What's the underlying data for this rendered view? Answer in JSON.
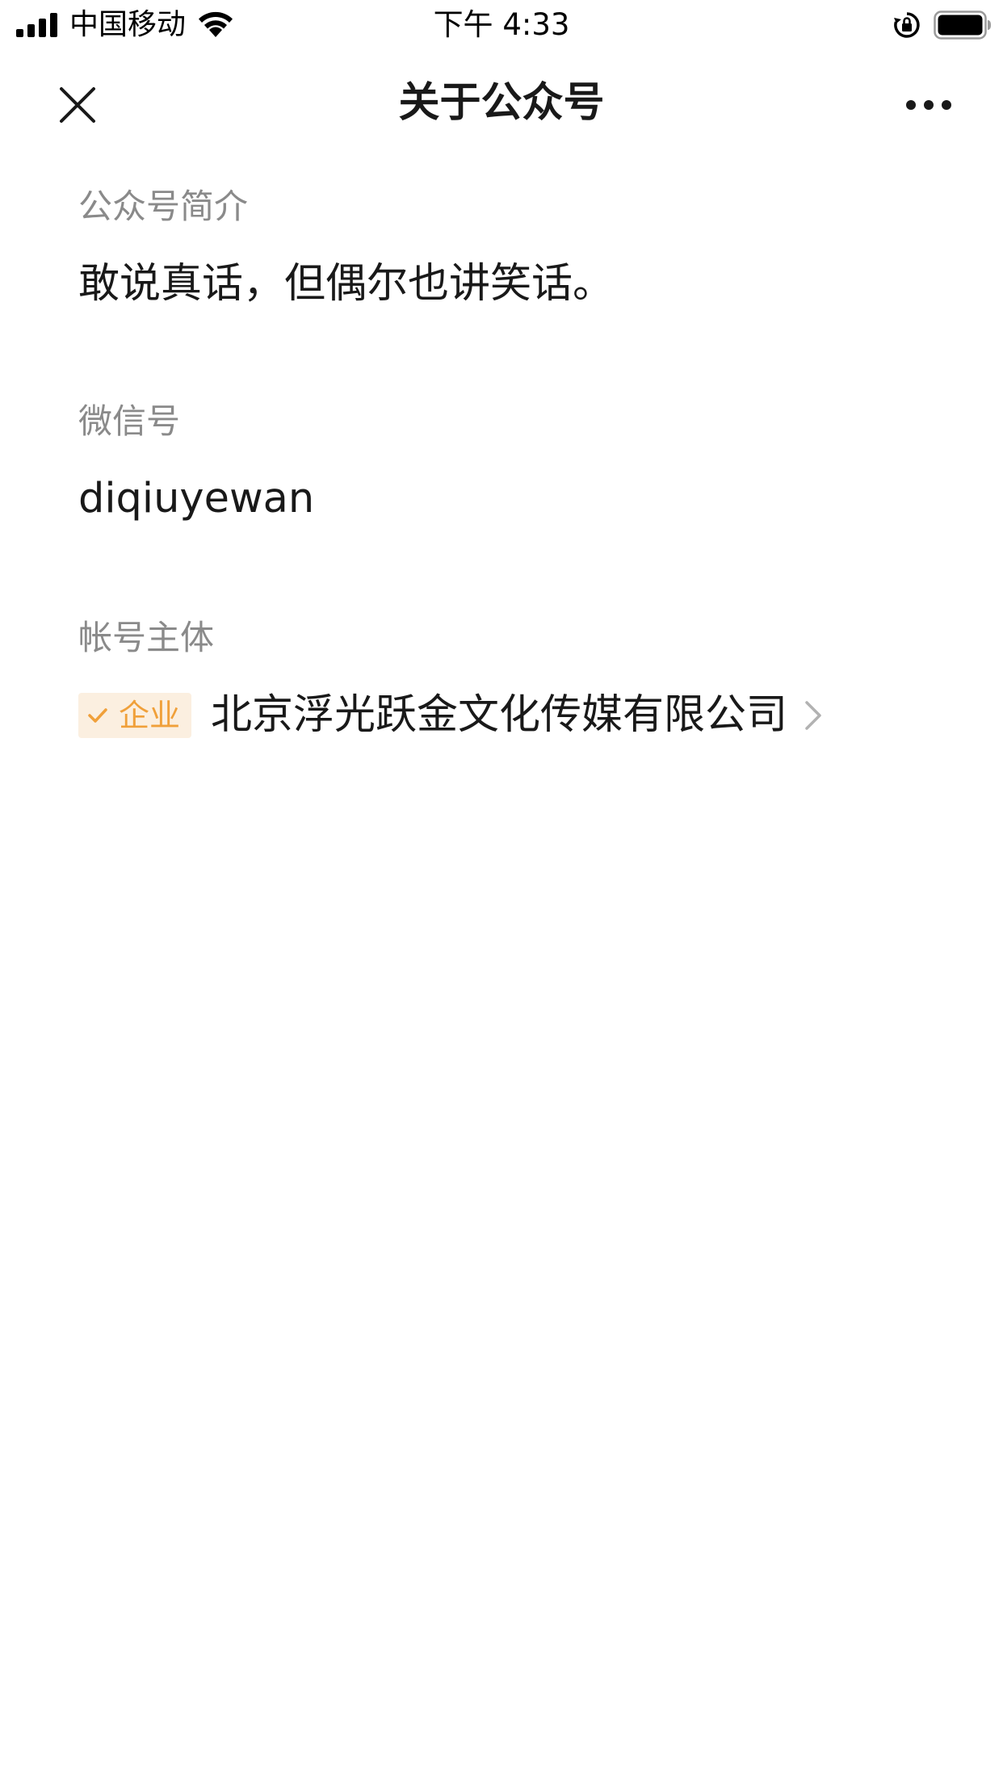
{
  "status_bar": {
    "carrier": "中国移动",
    "time": "下午 4:33",
    "icons": [
      "signal-icon",
      "wifi-icon",
      "rotation-lock-icon",
      "battery-icon"
    ]
  },
  "nav": {
    "title": "关于公众号",
    "close_icon": "close-icon",
    "more_icon": "more-icon"
  },
  "intro": {
    "label": "公众号简介",
    "value": "敢说真话，但偶尔也讲笑话。"
  },
  "wechat_id": {
    "label": "微信号",
    "value": "diqiuyewan"
  },
  "entity": {
    "label": "帐号主体",
    "badge": "企业",
    "badge_icon": "check-icon",
    "name": "北京浮光跃金文化传媒有限公司",
    "chevron_icon": "chevron-right-icon"
  },
  "colors": {
    "label": "#8a8a8a",
    "text": "#191919",
    "badge_bg": "#fbefe0",
    "badge_text": "#f0a03a",
    "chevron": "#b2b2b2"
  }
}
